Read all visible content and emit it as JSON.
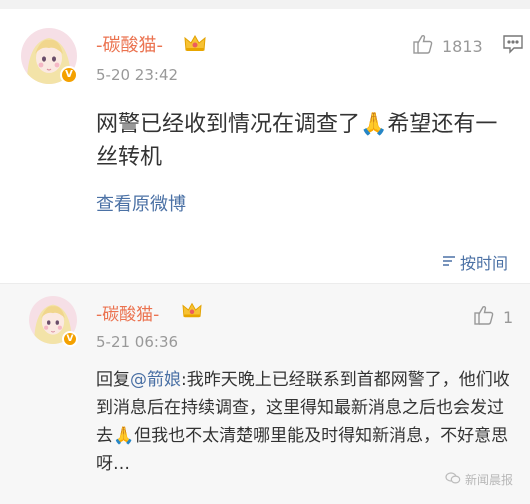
{
  "comment": {
    "username": "-碳酸猫-",
    "timestamp": "5-20 23:42",
    "like_count": "1813",
    "text_before": "网警已经收到情况在调查了",
    "emoji": "🙏",
    "text_after": "希望还有一丝转机",
    "view_original": "查看原微博"
  },
  "sort": {
    "label": "按时间"
  },
  "reply": {
    "username": "-碳酸猫-",
    "timestamp": "5-21 06:36",
    "like_count": "1",
    "prefix": "回复",
    "mention": "@箭娘",
    "text_before": ":我昨天晚上已经联系到首都网警了，他们收到消息后在持续调查，这里得知最新消息之后也会发过去",
    "emoji": "🙏",
    "text_after": "但我也不太清楚哪里能及时得知新消息，不好意思呀…"
  },
  "watermark": {
    "text": "新闻晨报"
  },
  "colors": {
    "username": "#eb7350",
    "link": "#4b71a5",
    "meta": "#999999",
    "badge": "#f4a100"
  }
}
